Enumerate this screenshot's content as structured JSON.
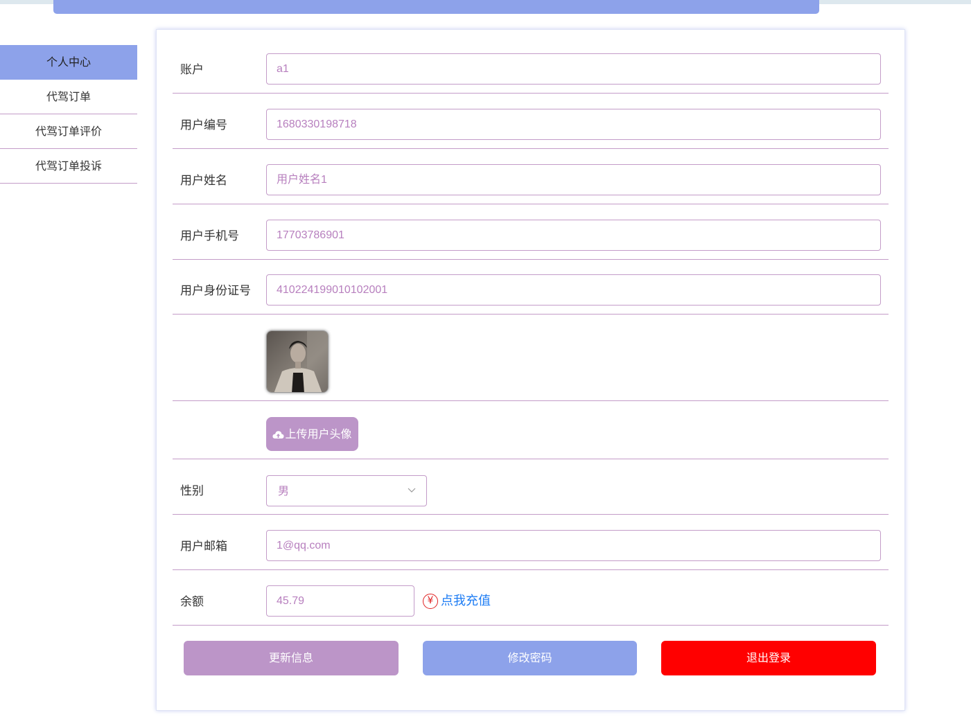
{
  "sidebar": {
    "items": [
      {
        "label": "个人中心",
        "active": true
      },
      {
        "label": "代驾订单",
        "active": false
      },
      {
        "label": "代驾订单评价",
        "active": false
      },
      {
        "label": "代驾订单投诉",
        "active": false
      }
    ]
  },
  "form": {
    "account": {
      "label": "账户",
      "value": "a1"
    },
    "user_number": {
      "label": "用户编号",
      "value": "1680330198718"
    },
    "user_name": {
      "label": "用户姓名",
      "value": "用户姓名1"
    },
    "user_phone": {
      "label": "用户手机号",
      "value": "17703786901"
    },
    "user_idcard": {
      "label": "用户身份证号",
      "value": "410224199010102001"
    },
    "upload_avatar_label": "上传用户头像",
    "gender": {
      "label": "性别",
      "value": "男"
    },
    "email": {
      "label": "用户邮箱",
      "value": "1@qq.com"
    },
    "balance": {
      "label": "余额",
      "value": "45.79",
      "recharge_label": "点我充值",
      "recharge_icon": "¥"
    }
  },
  "actions": {
    "update_label": "更新信息",
    "change_password_label": "修改密码",
    "logout_label": "退出登录"
  },
  "colors": {
    "accent_blue": "#8da2ea",
    "accent_purple": "#bc95c8",
    "danger": "#ff0000",
    "link": "#1d7cf4"
  }
}
